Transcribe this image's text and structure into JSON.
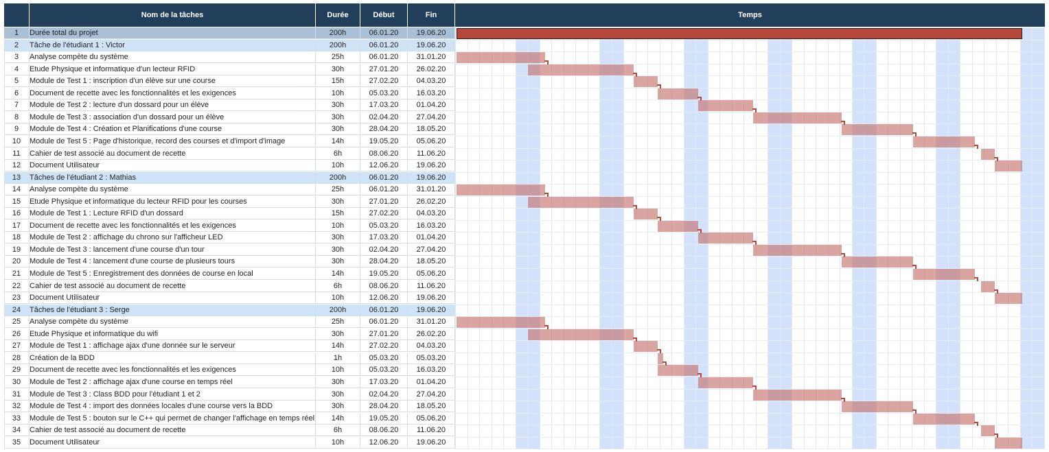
{
  "headers": {
    "name": "Nom de la tâches",
    "duration": "Durée",
    "start": "Début",
    "end": "Fin",
    "time": "Temps"
  },
  "colors": {
    "header_bg": "#213f5b",
    "total_row": "#a8bfd6",
    "student_row": "#cfe3f7",
    "week_band": "#d3e2fb",
    "total_bar": "#b5473a",
    "task_bar": "#d79c97"
  },
  "timeline": {
    "start": "06.01.20",
    "end": "19.06.20",
    "day_count": 165
  },
  "tasks": [
    {
      "num": "1",
      "name": "Durée total du projet",
      "duration": "200h",
      "start": "06.01.20",
      "end": "19.06.20",
      "kind": "total"
    },
    {
      "num": "2",
      "name": "Tâche de l'étudiant 1 : Victor",
      "duration": "200h",
      "start": "06.01.20",
      "end": "19.06.20",
      "kind": "student"
    },
    {
      "num": "3",
      "name": "Analyse compète du système",
      "duration": "25h",
      "start": "06.01.20",
      "end": "31.01.20",
      "kind": "task"
    },
    {
      "num": "4",
      "name": "Etude Physique et informatique d'un lecteur RFID",
      "duration": "30h",
      "start": "27.01.20",
      "end": "26.02.20",
      "kind": "task"
    },
    {
      "num": "5",
      "name": "Module de Test 1 : inscription d'un élève sur une course",
      "duration": "15h",
      "start": "27.02.20",
      "end": "04.03.20",
      "kind": "task"
    },
    {
      "num": "6",
      "name": "Document de recette avec les fonctionnalités et les exigences",
      "duration": "10h",
      "start": "05.03.20",
      "end": "16.03.20",
      "kind": "task"
    },
    {
      "num": "7",
      "name": "Module de Test 2 : lecture d'un dossard pour un élève",
      "duration": "30h",
      "start": "17.03.20",
      "end": "01.04.20",
      "kind": "task"
    },
    {
      "num": "8",
      "name": "Module de Test 3 : association d'un dossard pour un élève",
      "duration": "30h",
      "start": "02.04.20",
      "end": "27.04.20",
      "kind": "task"
    },
    {
      "num": "9",
      "name": " Module de Test 4 : Création et Planifications d'une course",
      "duration": "30h",
      "start": "28.04.20",
      "end": "18.05.20",
      "kind": "task"
    },
    {
      "num": "10",
      "name": "Module de Test 5 : Page d'historique, record des courses et d'import d'image",
      "duration": "14h",
      "start": "19.05.20",
      "end": "05.06.20",
      "kind": "task"
    },
    {
      "num": "11",
      "name": "Cahier de test associé au document de recette",
      "duration": "6h",
      "start": "08.06.20",
      "end": "11.06.20",
      "kind": "task"
    },
    {
      "num": "12",
      "name": "Document Utilisateur",
      "duration": "10h",
      "start": "12.06.20",
      "end": "19.06.20",
      "kind": "task"
    },
    {
      "num": "13",
      "name": "Tâches de l'étudiant 2 : Mathias",
      "duration": "200h",
      "start": "06.01.20",
      "end": "19.06.20",
      "kind": "student"
    },
    {
      "num": "14",
      "name": "Analyse compète du système",
      "duration": "25h",
      "start": "06.01.20",
      "end": "31.01.20",
      "kind": "task"
    },
    {
      "num": "15",
      "name": "Etude Physique et informatique du lecteur RFID pour les courses",
      "duration": "30h",
      "start": "27.01.20",
      "end": "26.02.20",
      "kind": "task"
    },
    {
      "num": "16",
      "name": "Module de Test 1 : Lecture RFID d'un dossard",
      "duration": "15h",
      "start": "27.02.20",
      "end": "04.03.20",
      "kind": "task"
    },
    {
      "num": "17",
      "name": "Document de recette avec les fonctionnalités et les exigences",
      "duration": "10h",
      "start": "05.03.20",
      "end": "16.03.20",
      "kind": "task"
    },
    {
      "num": "18",
      "name": "Module de Test 2 : affichage du chrono sur l'afficheur LED",
      "duration": "30h",
      "start": "17.03.20",
      "end": "01.04.20",
      "kind": "task"
    },
    {
      "num": "19",
      "name": "Module de Test 3 : lancement d'une course d'un tour",
      "duration": "30h",
      "start": "02.04.20",
      "end": "27.04.20",
      "kind": "task"
    },
    {
      "num": "20",
      "name": "Module de Test 4 : lancement d'une course de plusieurs tours",
      "duration": "30h",
      "start": "28.04.20",
      "end": "18.05.20",
      "kind": "task"
    },
    {
      "num": "21",
      "name": "Module de Test 5 : Enregistrement des données de course en local",
      "duration": "14h",
      "start": "19.05.20",
      "end": "05.06.20",
      "kind": "task"
    },
    {
      "num": "22",
      "name": "Cahier de test associé au document de recette",
      "duration": "6h",
      "start": "08.06.20",
      "end": "11.06.20",
      "kind": "task"
    },
    {
      "num": "23",
      "name": "Document Utilisateur",
      "duration": "10h",
      "start": " 12.06.20",
      "end": "19.06.20",
      "kind": "task"
    },
    {
      "num": "24",
      "name": "Tâches de l'étudiant 3 : Serge",
      "duration": "200h",
      "start": "06.01.20",
      "end": "19.06.20",
      "kind": "student"
    },
    {
      "num": "25",
      "name": "Analyse compète du système",
      "duration": "25h",
      "start": "06.01.20",
      "end": "31.01.20",
      "kind": "task"
    },
    {
      "num": "26",
      "name": "Etude Physique et informatique du wifi",
      "duration": "30h",
      "start": "27.01.20",
      "end": "26.02.20",
      "kind": "task"
    },
    {
      "num": "27",
      "name": "Module de Test 1 : affichage ajax d'une donnée sur le serveur",
      "duration": "14h",
      "start": "27.02.20",
      "end": "04.03.20",
      "kind": "task"
    },
    {
      "num": "28",
      "name": "Création de la BDD",
      "duration": "1h",
      "start": "05.03.20",
      "end": "05.03.20",
      "kind": "task"
    },
    {
      "num": "29",
      "name": "Document de recette avec les fonctionnalités et les exigences",
      "duration": "10h",
      "start": " 05.03.20",
      "end": "16.03.20",
      "kind": "task"
    },
    {
      "num": "30",
      "name": "Module de Test 2 : affichage ajax d'une course en temps réel",
      "duration": "30h",
      "start": "17.03.20",
      "end": "01.04.20",
      "kind": "task"
    },
    {
      "num": "31",
      "name": "Module de Test 3 : Class BDD pour l'étudiant 1 et 2",
      "duration": "30h",
      "start": "02.04.20",
      "end": "27.04.20",
      "kind": "task"
    },
    {
      "num": "32",
      "name": "Module de Test 4 : import des données locales d'une course vers la BDD",
      "duration": "30h",
      "start": "28.04.20",
      "end": "18.05.20",
      "kind": "task"
    },
    {
      "num": "33",
      "name": "Module de Test 5 : bouton sur le C++ qui permet de changer l'affichage en temps réel",
      "duration": "14h",
      "start": "19.05.20",
      "end": "05.06.20",
      "kind": "task"
    },
    {
      "num": "34",
      "name": "Cahier de test associé au document de recette",
      "duration": "6h",
      "start": "08.06.20",
      "end": "11.06.20",
      "kind": "task"
    },
    {
      "num": "35",
      "name": "Document Utilisateur",
      "duration": "10h",
      "start": "12.06.20",
      "end": "19.06.20",
      "kind": "task"
    }
  ]
}
